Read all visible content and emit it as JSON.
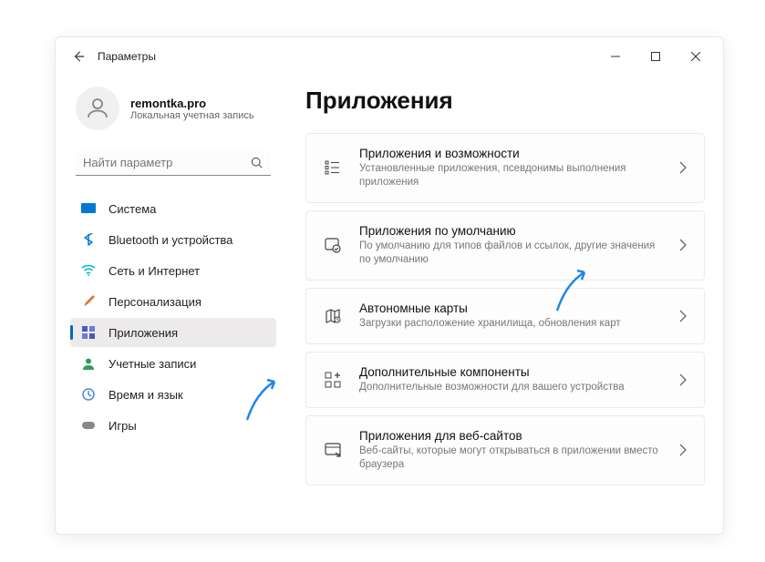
{
  "titlebar": {
    "title": "Параметры"
  },
  "account": {
    "name": "remontka.pro",
    "subtitle": "Локальная учетная запись"
  },
  "search": {
    "placeholder": "Найти параметр"
  },
  "nav": {
    "items": [
      {
        "label": "Система",
        "icon": "system",
        "active": false
      },
      {
        "label": "Bluetooth и устройства",
        "icon": "bluetooth",
        "active": false
      },
      {
        "label": "Сеть и Интернет",
        "icon": "network",
        "active": false
      },
      {
        "label": "Персонализация",
        "icon": "personalize",
        "active": false
      },
      {
        "label": "Приложения",
        "icon": "apps",
        "active": true
      },
      {
        "label": "Учетные записи",
        "icon": "accounts",
        "active": false
      },
      {
        "label": "Время и язык",
        "icon": "time",
        "active": false
      },
      {
        "label": "Игры",
        "icon": "games",
        "active": false
      }
    ]
  },
  "main": {
    "title": "Приложения",
    "cards": [
      {
        "title": "Приложения и возможности",
        "subtitle": "Установленные приложения, псевдонимы выполнения приложения",
        "icon": "apps-features"
      },
      {
        "title": "Приложения по умолчанию",
        "subtitle": "По умолчанию для типов файлов и ссылок, другие значения по умолчанию",
        "icon": "default-apps"
      },
      {
        "title": "Автономные карты",
        "subtitle": "Загрузки расположение хранилища, обновления карт",
        "icon": "maps"
      },
      {
        "title": "Дополнительные компоненты",
        "subtitle": "Дополнительные возможности для вашего устройства",
        "icon": "components"
      },
      {
        "title": "Приложения для веб-сайтов",
        "subtitle": "Веб-сайты, которые могут открываться в приложении вместо браузера",
        "icon": "web-apps"
      }
    ]
  }
}
